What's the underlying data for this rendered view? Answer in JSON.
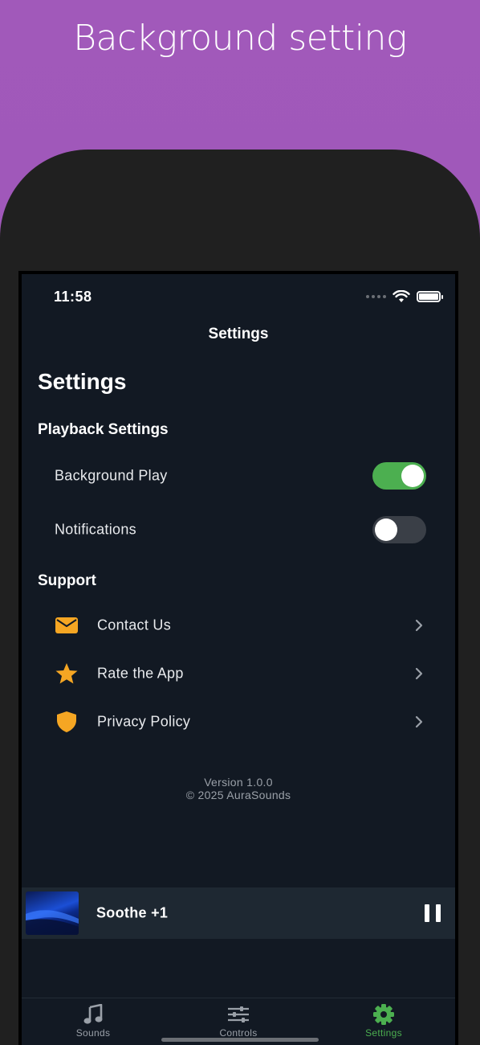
{
  "promo": {
    "title": "Background setting"
  },
  "status_bar": {
    "time": "11:58"
  },
  "nav": {
    "title": "Settings"
  },
  "page": {
    "large_title": "Settings"
  },
  "playback": {
    "header": "Playback Settings",
    "items": [
      {
        "label": "Background Play",
        "enabled": true
      },
      {
        "label": "Notifications",
        "enabled": false
      }
    ]
  },
  "support": {
    "header": "Support",
    "items": [
      {
        "label": "Contact Us",
        "icon": "envelope-icon"
      },
      {
        "label": "Rate the App",
        "icon": "star-icon"
      },
      {
        "label": "Privacy Policy",
        "icon": "shield-icon"
      }
    ]
  },
  "footer": {
    "version": "Version 1.0.0",
    "copyright": "© 2025 AuraSounds"
  },
  "now_playing": {
    "title": "Soothe +1"
  },
  "tabs": [
    {
      "label": "Sounds",
      "icon": "music-note-icon",
      "active": false
    },
    {
      "label": "Controls",
      "icon": "sliders-icon",
      "active": false
    },
    {
      "label": "Settings",
      "icon": "gear-icon",
      "active": true
    }
  ],
  "colors": {
    "accent": "#4caf50",
    "icon_orange": "#f5a623",
    "background": "#121923",
    "promo_purple": "#a159ba"
  }
}
